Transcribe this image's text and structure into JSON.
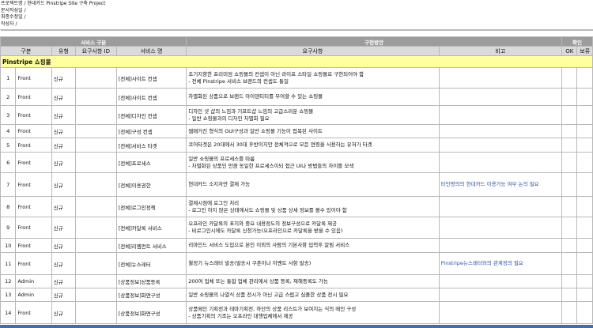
{
  "meta": {
    "line1": "프로젝트명 / 현대카드 Pinstripe Site 구축 Project",
    "line2": "문서작성일 /",
    "line3": "최종수정일 /",
    "line4": "작성자 /"
  },
  "header": {
    "group_service": "서비스 구분",
    "group_plan": "구현방안",
    "group_confirm": "확인",
    "col_type": "구분",
    "col_kind": "유형",
    "col_req_id": "요구사항 ID",
    "col_service_name": "서비스 명",
    "col_requirement": "요구사항",
    "col_note": "비고",
    "col_ok": "OK",
    "col_hold": "보류"
  },
  "section_title": "Pinstripe 쇼핑몰",
  "rows": [
    {
      "no": "1",
      "type": "Front",
      "kind": "신규",
      "service": "[전체]사이트 컨셉",
      "req1": "초기지향한 프리미엄 쇼핑몰의 컨셉이 아닌 라이프 스타일 쇼핑몰로 구현되어야 함",
      "req2": "- 전체 Pinstripe 서비스 브랜드의 컨셉도 통일",
      "note": ""
    },
    {
      "no": "2",
      "type": "Front",
      "kind": "신규",
      "service": "[전체]사이트 컨셉",
      "req1": "차별화된 상품으로 브랜드 아이덴티티를 부여할 수 있는 쇼핑몰",
      "req2": "",
      "note": ""
    },
    {
      "no": "3",
      "type": "Front",
      "kind": "신규",
      "service": "[전체]디자인 컨셉",
      "req1": "디자인 샷 샵의 느낌과 기프트샵 느낌의 고급스러운 쇼핑몰",
      "req2": "- 일반 쇼핑몰과의 디자인 차별화 필요",
      "note": ""
    },
    {
      "no": "4",
      "type": "Front",
      "kind": "신규",
      "service": "[전체]구성 컨셉",
      "req1": "웹매거진 형식의 GUI구성과 일반 쇼핑몰 기능이 접목된 사이트",
      "req2": "",
      "note": ""
    },
    {
      "no": "5",
      "type": "Front",
      "kind": "신규",
      "service": "[전체]서비스 타겟",
      "req1": "코어타겟은 20대에서 30대 후반이지만 전체적으로 모든 연령을 사용하는 유저가 타겟",
      "req2": "",
      "note": ""
    },
    {
      "no": "6",
      "type": "Front",
      "kind": "신규",
      "service": "[전체]프로세스",
      "req1": "일반 쇼핑몰의 프로세스를 따름",
      "req2": "- 차별화된 상품인 만큼 동일한 프로세스이되 접근 UI나 방법들의 차이를 모색",
      "note": ""
    },
    {
      "no": "7",
      "type": "Front",
      "kind": "신규",
      "service": "[전체]이용권한",
      "req1": "현대카드 소지자만 결제 가능",
      "req2": "",
      "note": "타인명의의 현대카드 이용가능 여부 논의 필요"
    },
    {
      "no": "8",
      "type": "Front",
      "kind": "신규",
      "service": "[전체]로그인정책",
      "req1": "결제시점에 로그인 처리",
      "req2": "- 로그인 하지 않은 상태에서도 쇼핑몰 및 상품 상세 정보를 볼수 있어야 함",
      "note": ""
    },
    {
      "no": "9",
      "type": "Front",
      "kind": "신규",
      "service": "[전체]카달록 서비스",
      "req1": "오프라인 카달록의 표지와 중요 내용정도의 정보구성으로 카달록 제공",
      "req2": "- 비로그인시에도 카달록 신청가능(오프라인으로 카달록을 받을 수 있음)",
      "note": ""
    },
    {
      "no": "10",
      "type": "Front",
      "kind": "신규",
      "service": "[전체]리멤먼트 서비스",
      "req1": "리마인드 서비스 도입으로 본인 이외의 사람의 기본사항 입력후 알림 서비스",
      "req2": "",
      "note": ""
    },
    {
      "no": "11",
      "type": "Front",
      "kind": "신규",
      "service": "[전체]뉴스레터",
      "req1": "월정기 뉴스레터 발송(발송시 쿠폰이나 이벤트 사항 발송)",
      "req2": "",
      "note": "Pinstripe뉴스레터와의 관계정의 필요"
    },
    {
      "no": "12",
      "type": "Admin",
      "kind": "신규",
      "service": "[상품정보]상품등록",
      "req1": "200여 업체 또는 통합 업체 관리에서 상품 등록, 재해등록도 가능",
      "req2": "",
      "note": ""
    },
    {
      "no": "13",
      "type": "Admin",
      "kind": "신규",
      "service": "[상품정보]화면구성",
      "req1": "일반 쇼핑몰의 나열식 상품 전시가 아닌 고급 스럽고 심플한 상품 전시 필요",
      "req2": "",
      "note": ""
    },
    {
      "no": "14",
      "type": "Front",
      "kind": "신규",
      "service": "[상품정보]화면구성",
      "req1": "상품메인 기획전과 테마기획전, 하단의 상품 리스트가 보여지는 식의 메인 구성",
      "req2": "- 상품기획의 기조는 오프라인 대행업체에서 제공",
      "note": ""
    }
  ]
}
